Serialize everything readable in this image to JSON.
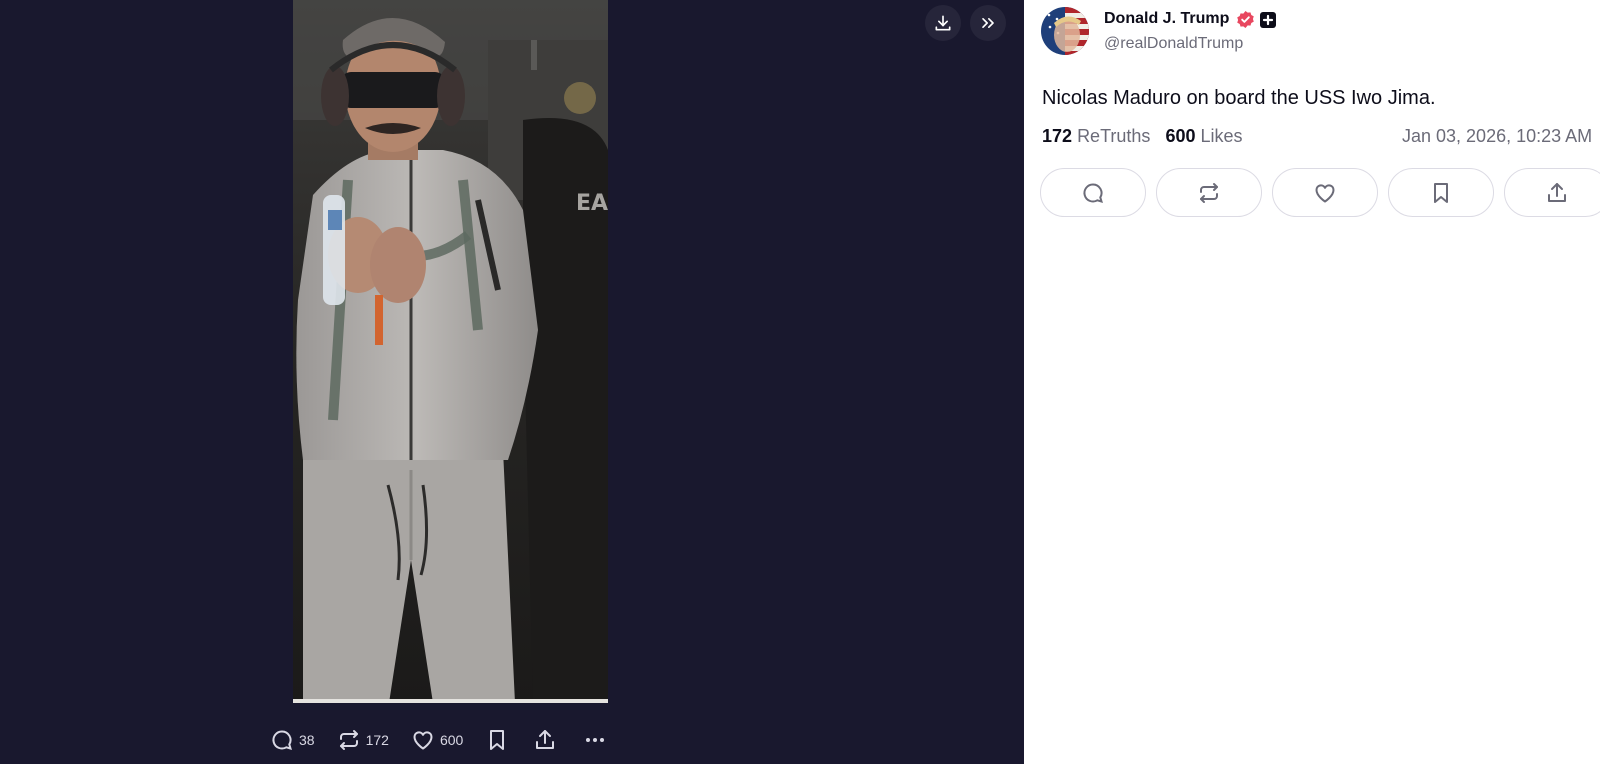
{
  "post": {
    "author_name": "Donald J. Trump",
    "handle": "@realDonaldTrump",
    "text": "Nicolas Maduro on board the USS Iwo Jima.",
    "retruths_count": "172",
    "retruths_label": "ReTruths",
    "likes_count": "600",
    "likes_label": "Likes",
    "timestamp": "Jan 03, 2026, 10:23 AM"
  },
  "media_bar": {
    "replies": "38",
    "retruths": "172",
    "likes": "600"
  },
  "icons": {
    "viewer_top": [
      "download-icon",
      "chevrons-right-icon"
    ],
    "media_bar": [
      "comment-icon",
      "retruth-icon",
      "heart-icon",
      "bookmark-icon",
      "share-icon",
      "more-icon"
    ],
    "post_actions": [
      "comment-icon",
      "retruth-icon",
      "heart-icon",
      "bookmark-icon",
      "share-icon"
    ],
    "badges": [
      "verified-badge-icon",
      "plus-badge-icon"
    ]
  },
  "colors": {
    "viewer_background": "#19182e",
    "verified_badge": "#e8475f",
    "text_primary": "#0d0d1a",
    "text_secondary": "#6b6b78"
  }
}
